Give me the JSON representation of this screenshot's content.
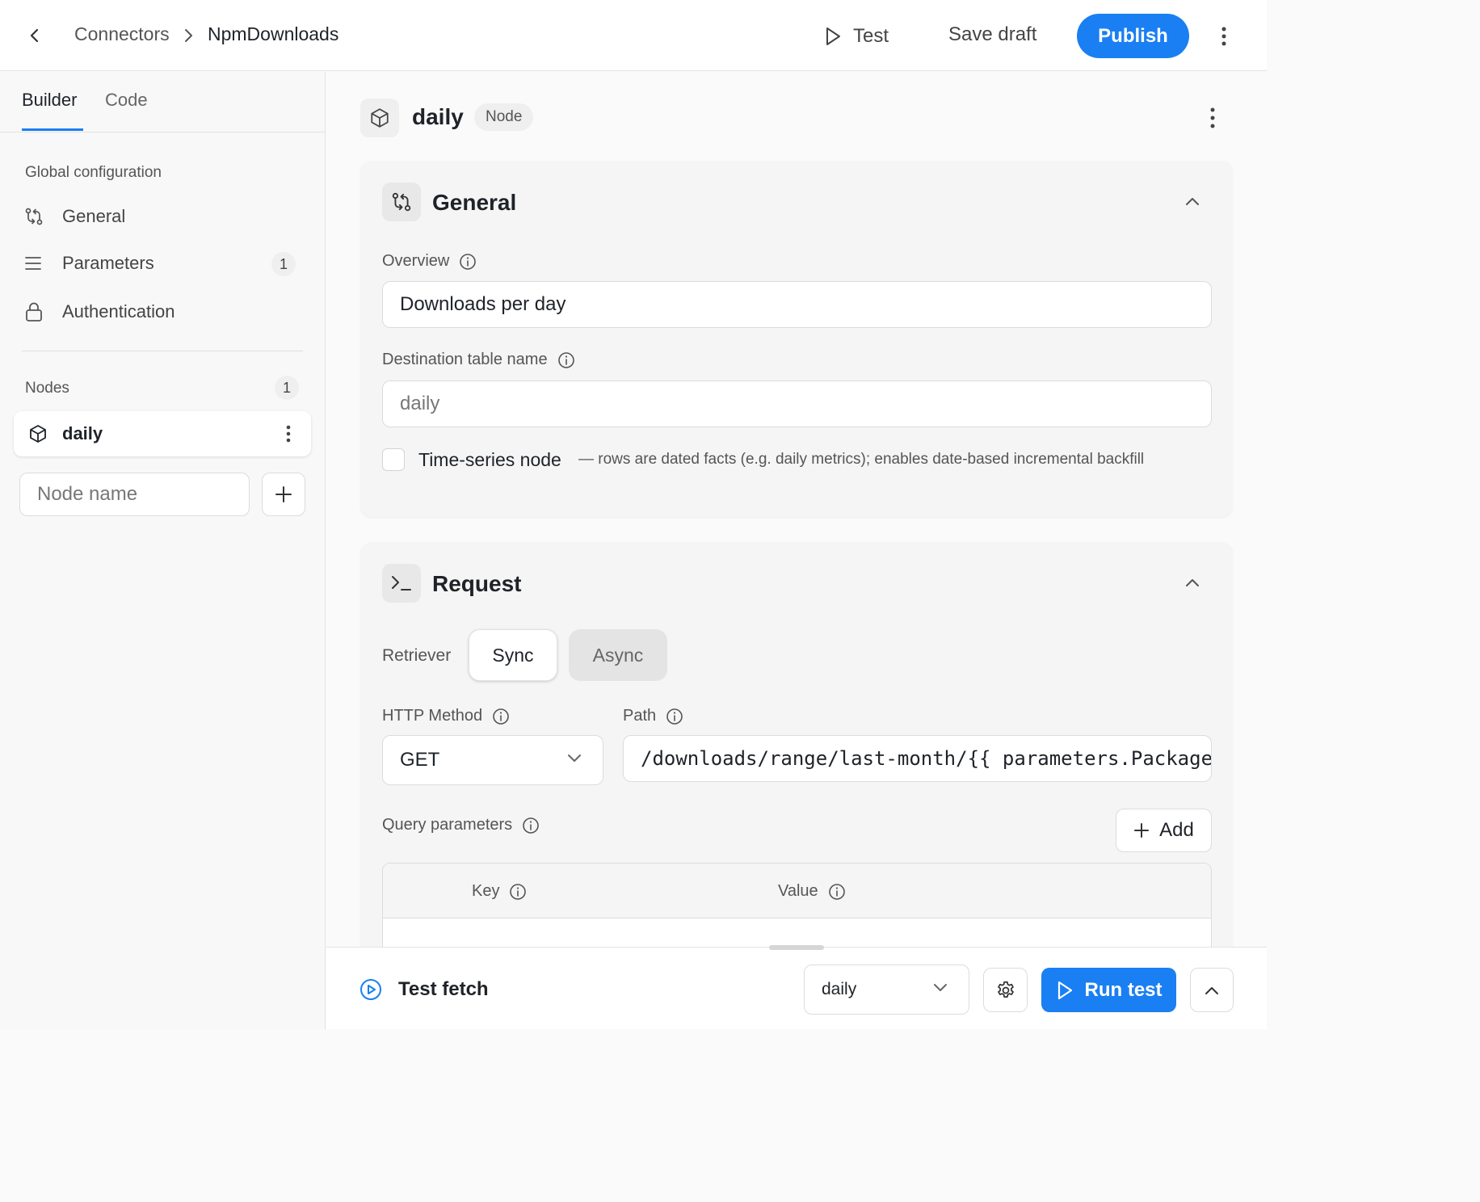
{
  "header": {
    "breadcrumb": [
      "Connectors",
      "NpmDownloads"
    ],
    "test_label": "Test",
    "save_draft_label": "Save draft",
    "publish_label": "Publish"
  },
  "sidebar": {
    "tabs": [
      {
        "label": "Builder",
        "active": true
      },
      {
        "label": "Code",
        "active": false
      }
    ],
    "global_config_heading": "Global configuration",
    "items": [
      {
        "label": "General",
        "icon": "git-compare-icon"
      },
      {
        "label": "Parameters",
        "icon": "menu-lines-icon",
        "count": "1"
      },
      {
        "label": "Authentication",
        "icon": "lock-icon"
      }
    ],
    "nodes_heading": "Nodes",
    "nodes_count": "1",
    "nodes": [
      {
        "label": "daily",
        "icon": "cube-icon"
      }
    ],
    "node_name_placeholder": "Node name"
  },
  "node": {
    "title": "daily",
    "badge": "Node"
  },
  "general": {
    "title": "General",
    "overview_label": "Overview",
    "overview_value": "Downloads per day",
    "destination_label": "Destination table name",
    "destination_placeholder": "daily",
    "timeseries_label": "Time-series node",
    "timeseries_checked": false,
    "timeseries_hint": "— rows are dated facts (e.g. daily metrics); enables date-based incremental backfill"
  },
  "request": {
    "title": "Request",
    "retriever_label": "Retriever",
    "retriever_options": [
      "Sync",
      "Async"
    ],
    "retriever_selected": "Sync",
    "http_method_label": "HTTP Method",
    "http_method_value": "GET",
    "path_label": "Path",
    "path_value": "/downloads/range/last-month/{{ parameters.Package }}",
    "query_params_label": "Query parameters",
    "add_label": "Add",
    "table_headers": [
      "Key",
      "Value"
    ]
  },
  "bottom": {
    "test_fetch_label": "Test fetch",
    "node_select_value": "daily",
    "run_test_label": "Run test"
  },
  "colors": {
    "accent": "#1a7ff2"
  }
}
